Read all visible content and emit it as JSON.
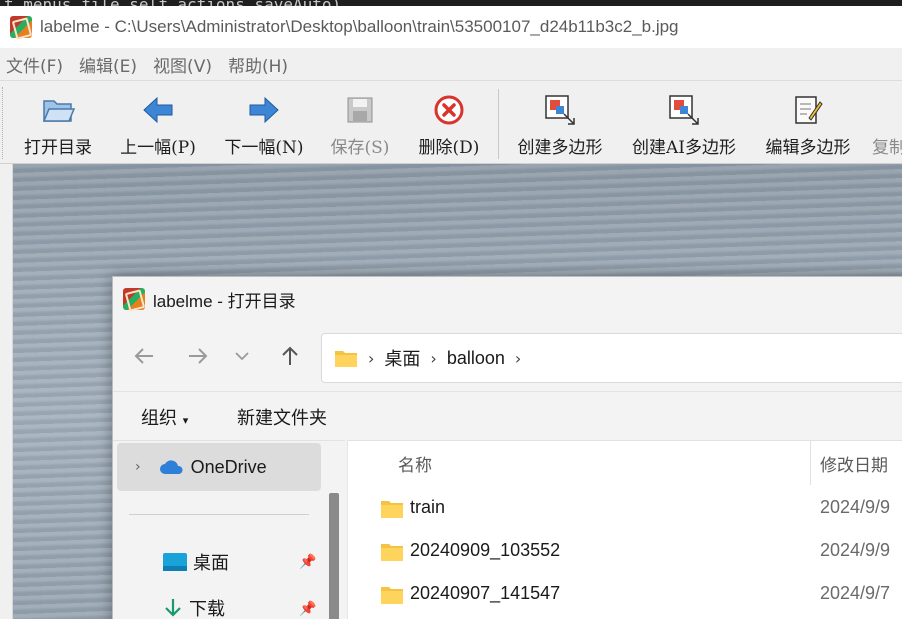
{
  "background_code": "t menus file  self actions saveAuto)",
  "window": {
    "title": "labelme - C:\\Users\\Administrator\\Desktop\\balloon\\train\\53500107_d24b11b3c2_b.jpg"
  },
  "menubar": {
    "items": [
      "文件(F)",
      "编辑(E)",
      "视图(V)",
      "帮助(H)"
    ]
  },
  "toolbar": {
    "buttons": [
      {
        "label": "打开目录",
        "icon": "folder-open-icon",
        "enabled": true
      },
      {
        "label": "上一幅(P)",
        "icon": "arrow-left-icon",
        "enabled": true
      },
      {
        "label": "下一幅(N)",
        "icon": "arrow-right-icon",
        "enabled": true
      },
      {
        "label": "保存(S)",
        "icon": "save-icon",
        "enabled": false
      },
      {
        "label": "删除(D)",
        "icon": "delete-icon",
        "enabled": true
      },
      {
        "label": "创建多边形",
        "icon": "create-polygon-icon",
        "enabled": true
      },
      {
        "label": "创建AI多边形",
        "icon": "create-ai-polygon-icon",
        "enabled": true
      },
      {
        "label": "编辑多边形",
        "icon": "edit-polygon-icon",
        "enabled": true
      },
      {
        "label": "复制",
        "icon": "copy-icon",
        "enabled": false
      }
    ]
  },
  "dialog": {
    "title": "labelme - 打开目录",
    "breadcrumb": [
      "桌面",
      "balloon"
    ],
    "commands": {
      "organize": "组织",
      "new_folder": "新建文件夹"
    },
    "sidebar": {
      "selected": "OneDrive",
      "items": [
        "桌面",
        "下载"
      ]
    },
    "columns": {
      "name": "名称",
      "modified": "修改日期"
    },
    "files": [
      {
        "name": "train",
        "modified": "2024/9/9"
      },
      {
        "name": "20240909_103552",
        "modified": "2024/9/9"
      },
      {
        "name": "20240907_141547",
        "modified": "2024/9/7"
      }
    ]
  },
  "colors": {
    "folder": "#f5c242",
    "accent_blue": "#2d7fd8",
    "delete_red": "#d9332b"
  }
}
